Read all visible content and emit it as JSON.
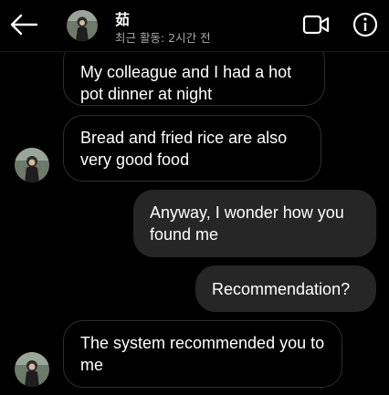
{
  "header": {
    "name": "茹",
    "status": "최근 활동: 2시간 전",
    "back_icon": "arrow-left-icon",
    "video_icon": "video-camera-icon",
    "info_icon": "info-circle-icon"
  },
  "messages": [
    {
      "direction": "incoming",
      "text": "My colleague and I had a hot pot dinner at night",
      "show_avatar": false
    },
    {
      "direction": "incoming",
      "text": "Bread and fried rice are also very good food",
      "show_avatar": true
    },
    {
      "direction": "outgoing",
      "text": "Anyway, I wonder how you found me"
    },
    {
      "direction": "outgoing",
      "text": "Recommendation?"
    },
    {
      "direction": "incoming",
      "text": "The system recommended you to me",
      "show_avatar": true
    }
  ],
  "colors": {
    "background": "#000000",
    "outgoing_bubble": "#262626",
    "incoming_border": "#2f2f2f",
    "secondary_text": "#a8a8a8"
  }
}
